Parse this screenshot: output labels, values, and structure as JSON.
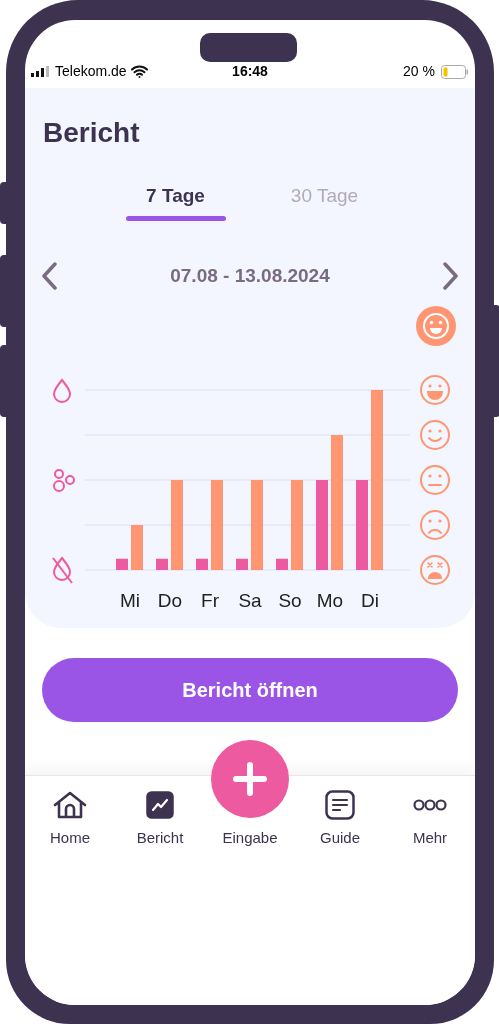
{
  "status_bar": {
    "carrier": "Telekom.de",
    "time": "16:48",
    "battery": "20 %"
  },
  "title": "Bericht",
  "tabs": [
    {
      "label": "7 Tage",
      "selected": true
    },
    {
      "label": "30 Tage",
      "selected": false
    }
  ],
  "period": {
    "range": "07.08 - 13.08.2024"
  },
  "chart": {
    "weekdays": [
      "Mi",
      "Do",
      "Fr",
      "Sa",
      "So",
      "Mo",
      "Di"
    ]
  },
  "primary_button": "Bericht öffnen",
  "nav": [
    {
      "label": "Home",
      "kind": "tab",
      "selected": false
    },
    {
      "label": "Bericht",
      "kind": "tab",
      "selected": true
    },
    {
      "label": "Eingabe",
      "kind": "action"
    },
    {
      "label": "Guide",
      "kind": "tab",
      "selected": false
    },
    {
      "label": "Mehr",
      "kind": "tab",
      "selected": false
    }
  ]
}
